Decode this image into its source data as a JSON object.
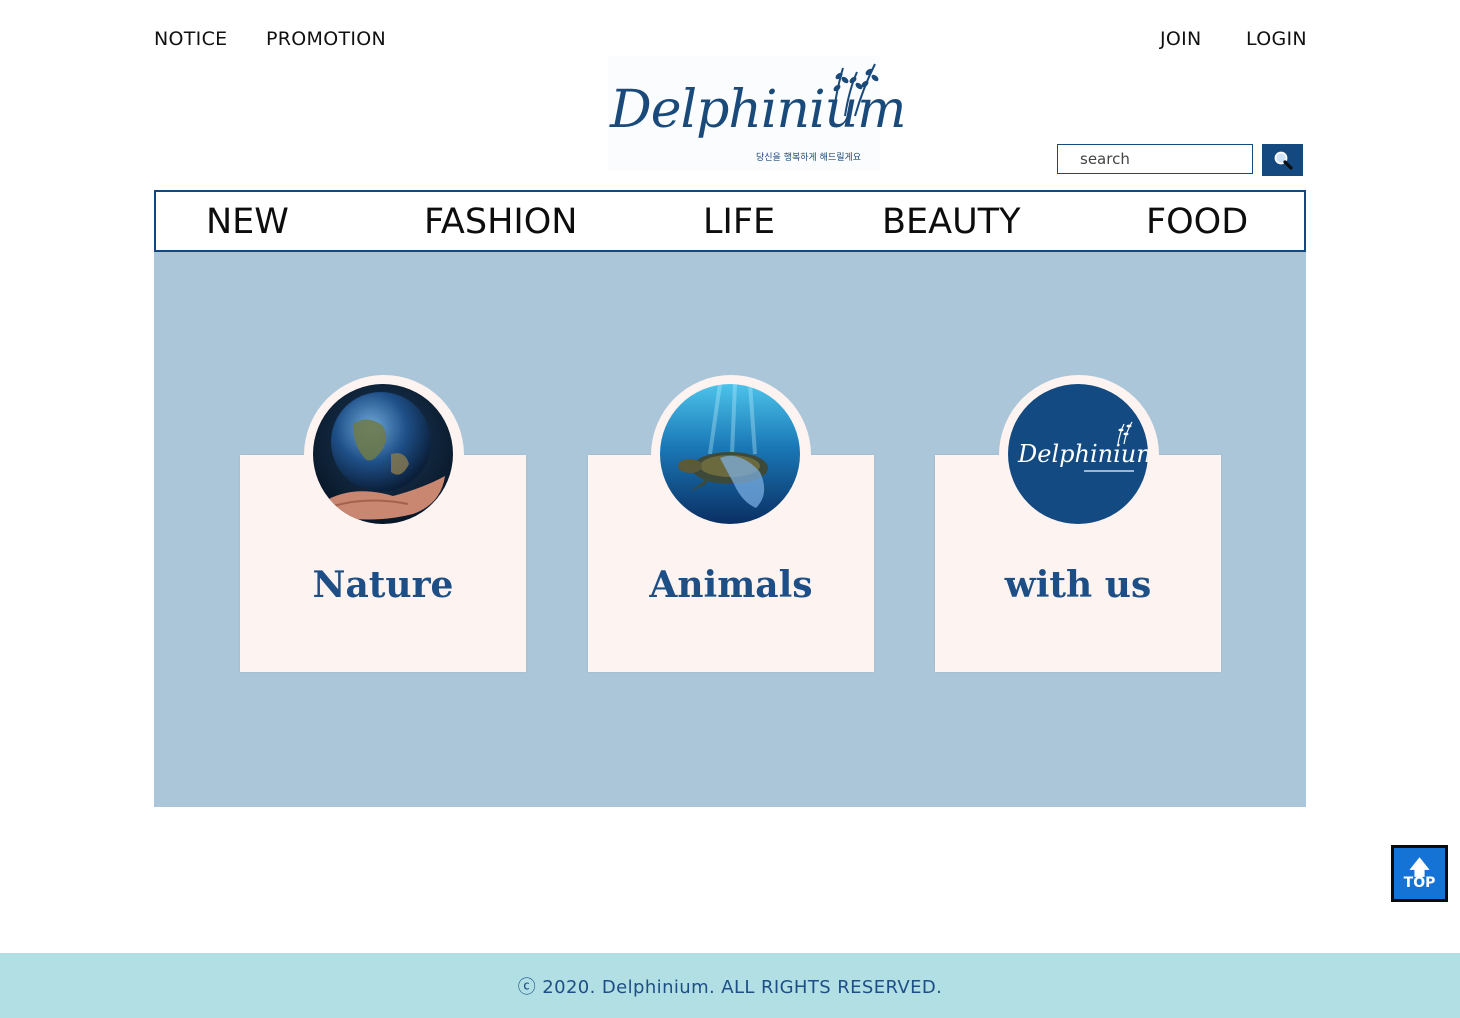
{
  "header": {
    "left_links": [
      "NOTICE",
      "PROMOTION"
    ],
    "right_links": [
      "JOIN",
      "LOGIN"
    ],
    "logo": {
      "name": "Delphinium",
      "tagline": "당신을 행복하게 해드릴게요"
    },
    "search": {
      "placeholder": "search",
      "button_icon": "search-icon"
    }
  },
  "nav": {
    "items": [
      "NEW",
      "FASHION",
      "LIFE",
      "BEAUTY",
      "FOOD"
    ]
  },
  "hero": {
    "cards": [
      {
        "title": "Nature",
        "image": "earth-in-hand-image"
      },
      {
        "title": "Animals",
        "image": "sea-turtle-image"
      },
      {
        "title": "with us",
        "image": "delphinium-logo-image",
        "logo_text": "Delphinium"
      }
    ]
  },
  "top_button": {
    "label": "TOP",
    "icon": "arrow-up-icon"
  },
  "footer": {
    "copyright": "ⓒ 2020. Delphinium. ALL RIGHTS RESERVED."
  },
  "colors": {
    "brand": "#13497e",
    "hero_bg": "#abc6d8",
    "card_bg": "#fdf3f1",
    "footer_bg": "#b1dfe4",
    "top_button": "#1573d6"
  }
}
